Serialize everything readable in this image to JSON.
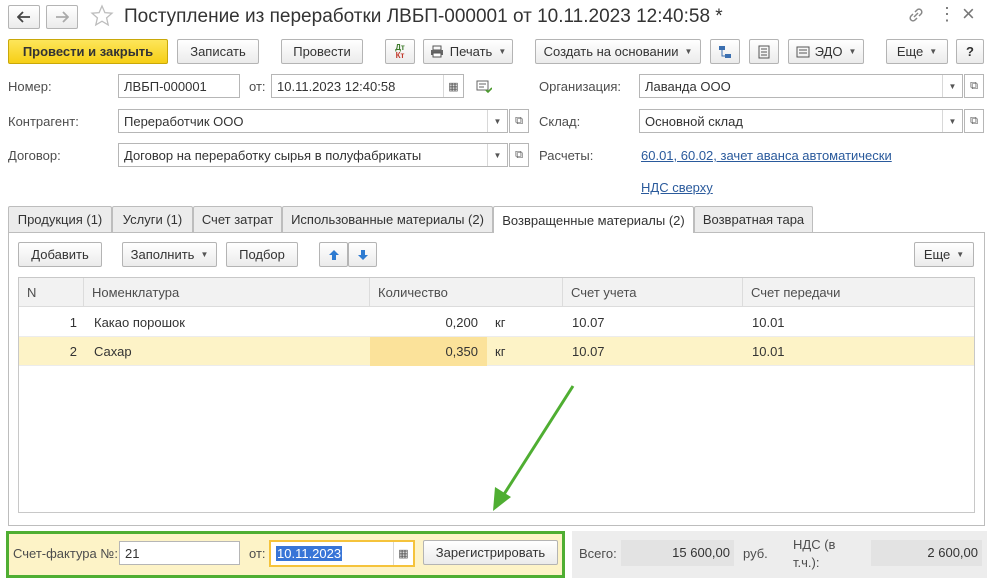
{
  "window": {
    "title": "Поступление из переработки ЛВБП-000001 от 10.11.2023 12:40:58 *",
    "more_glyph": "⋮",
    "close_glyph": "×"
  },
  "toolbar": {
    "post_close": "Провести и закрыть",
    "save": "Записать",
    "post": "Провести",
    "dtkt_top": "Дт",
    "dtkt_bottom": "Кт",
    "print": "Печать",
    "create_based": "Создать на основании",
    "edo": "ЭДО",
    "more": "Еще",
    "help": "?"
  },
  "header": {
    "number_label": "Номер:",
    "number_value": "ЛВБП-000001",
    "date_label": "от:",
    "date_value": "10.11.2023 12:40:58",
    "org_label": "Организация:",
    "org_value": "Лаванда ООО",
    "counterparty_label": "Контрагент:",
    "counterparty_value": "Переработчик ООО",
    "warehouse_label": "Склад:",
    "warehouse_value": "Основной склад",
    "contract_label": "Договор:",
    "contract_value": "Договор на переработку сырья в полуфабрикаты",
    "settlements_label": "Расчеты:",
    "settlements_link": "60.01, 60.02, зачет аванса автоматически",
    "vat_link": "НДС сверху"
  },
  "tabs": [
    {
      "label": "Продукция (1)"
    },
    {
      "label": "Услуги (1)"
    },
    {
      "label": "Счет затрат"
    },
    {
      "label": "Использованные материалы (2)"
    },
    {
      "label": "Возвращенные материалы (2)"
    },
    {
      "label": "Возвратная тара"
    }
  ],
  "table_toolbar": {
    "add": "Добавить",
    "fill": "Заполнить",
    "select": "Подбор",
    "more": "Еще"
  },
  "table": {
    "columns": [
      "N",
      "Номенклатура",
      "Количество",
      "Счет учета",
      "Счет передачи"
    ],
    "rows": [
      {
        "n": "1",
        "item": "Какао порошок",
        "qty": "0,200",
        "unit": "кг",
        "account": "10.07",
        "transfer_account": "10.01"
      },
      {
        "n": "2",
        "item": "Сахар",
        "qty": "0,350",
        "unit": "кг",
        "account": "10.07",
        "transfer_account": "10.01"
      }
    ]
  },
  "footer": {
    "invoice_label": "Счет-фактура №:",
    "invoice_number": "21",
    "invoice_date_label": "от:",
    "invoice_date": "10.11.2023",
    "register": "Зарегистрировать",
    "total_label": "Всего:",
    "total_value": "15 600,00",
    "currency": "руб.",
    "vat_label_line1": "НДС (в",
    "vat_label_line2": "т.ч.):",
    "vat_value": "2 600,00"
  },
  "colors": {
    "primary_button": "#f6cf15",
    "selected_row": "#fdf3c7",
    "selected_cell": "#fbe29a",
    "annotation_green": "#4fae32",
    "link": "#2a5a9c"
  }
}
